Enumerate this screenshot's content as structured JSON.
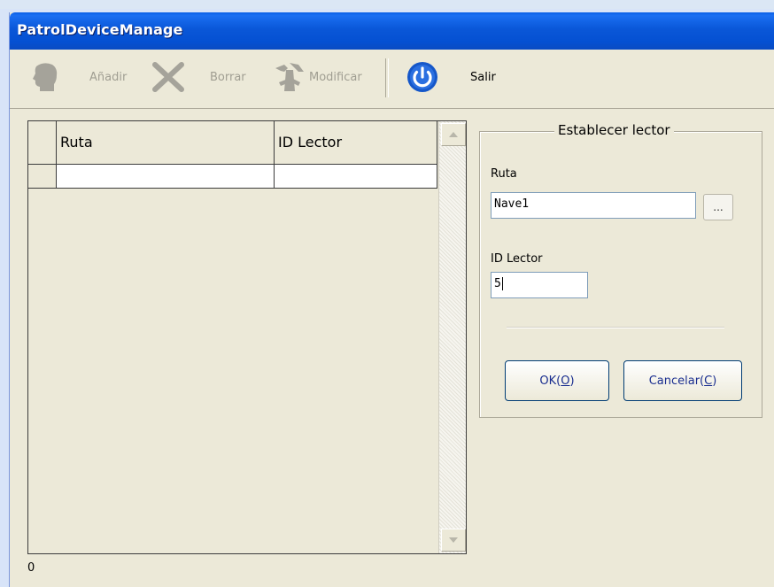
{
  "window": {
    "title": "PatrolDeviceManage"
  },
  "toolbar": {
    "add_label": "Añadir",
    "delete_label": "Borrar",
    "modify_label": "Modificar",
    "exit_label": "Salir",
    "icons": {
      "add": "user-head-icon",
      "delete": "cross-icon",
      "modify": "tools-icon",
      "exit": "power-icon"
    }
  },
  "grid": {
    "columns": [
      "Ruta",
      "ID Lector"
    ],
    "rows": [
      [
        "",
        ""
      ]
    ]
  },
  "form": {
    "group_title": "Establecer lector",
    "ruta_label": "Ruta",
    "ruta_value": "Nave1",
    "browse_label": "...",
    "id_label": "ID Lector",
    "id_value": "5",
    "ok_text": "OK(",
    "ok_key": "O",
    "ok_close": ")",
    "cancel_text": "Cancelar(",
    "cancel_key": "C",
    "cancel_close": ")"
  },
  "status": {
    "count": "0"
  },
  "colors": {
    "title_bar": "#0a57d8",
    "face": "#ece9d8",
    "button_text": "#1a2e8f",
    "exit_icon": "#1557c9"
  }
}
